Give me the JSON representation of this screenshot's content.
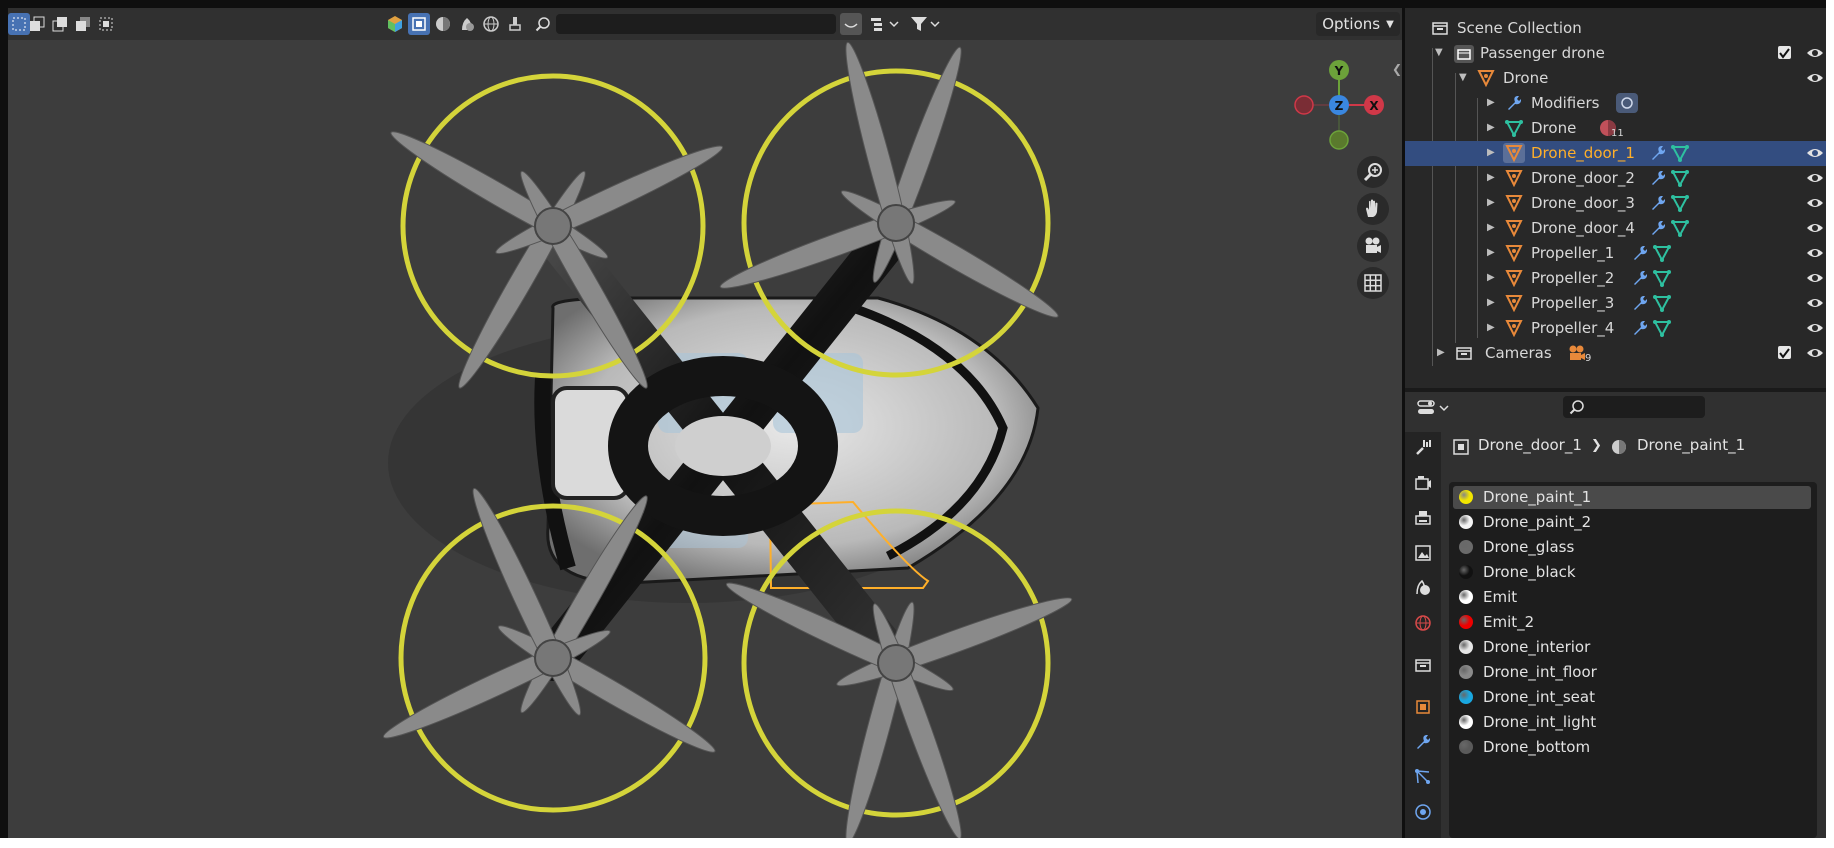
{
  "viewport": {
    "options_label": "Options",
    "toolbar_icons": [
      "select-box-icon",
      "select-extend-icon",
      "select-subtract-icon",
      "select-invert-icon",
      "select-intersect-icon"
    ],
    "header_icons": [
      "object-color-icon",
      "solid-shading-icon",
      "material-shading-icon",
      "rendered-shading-icon",
      "world-icon",
      "paint-icon",
      "search-icon"
    ],
    "gizmo": {
      "x": "X",
      "y": "Y",
      "z": "Z"
    }
  },
  "outliner": {
    "rows": [
      {
        "label": "Scene Collection"
      },
      {
        "label": "Passenger drone"
      },
      {
        "label": "Drone"
      },
      {
        "label": "Modifiers"
      },
      {
        "label": "Drone",
        "badge": "11"
      },
      {
        "label": "Drone_door_1"
      },
      {
        "label": "Drone_door_2"
      },
      {
        "label": "Drone_door_3"
      },
      {
        "label": "Drone_door_4"
      },
      {
        "label": "Propeller_1"
      },
      {
        "label": "Propeller_2"
      },
      {
        "label": "Propeller_3"
      },
      {
        "label": "Propeller_4"
      },
      {
        "label": "Cameras",
        "badge": "9"
      }
    ]
  },
  "properties": {
    "breadcrumb": {
      "object": "Drone_door_1",
      "material": "Drone_paint_1"
    },
    "materials": [
      {
        "name": "Drone_paint_1",
        "color": "#f2e600"
      },
      {
        "name": "Drone_paint_2",
        "color": "#f4f4f4"
      },
      {
        "name": "Drone_glass",
        "color": "#6a6a6a"
      },
      {
        "name": "Drone_black",
        "color": "#111111"
      },
      {
        "name": "Emit",
        "color": "#ffffff"
      },
      {
        "name": "Emit_2",
        "color": "#ee0000"
      },
      {
        "name": "Drone_interior",
        "color": "#e6e6e6"
      },
      {
        "name": "Drone_int_floor",
        "color": "#8a8a8a"
      },
      {
        "name": "Drone_int_seat",
        "color": "#19a7e0"
      },
      {
        "name": "Drone_int_light",
        "color": "#ffffff"
      },
      {
        "name": "Drone_bottom",
        "color": "#5a5a5a"
      }
    ],
    "selected_material_index": 0
  },
  "colors": {
    "accent": "#4772b3",
    "selected_row": "#334d80",
    "highlight_text": "#ffaf29",
    "ring": "#d4d43a"
  }
}
